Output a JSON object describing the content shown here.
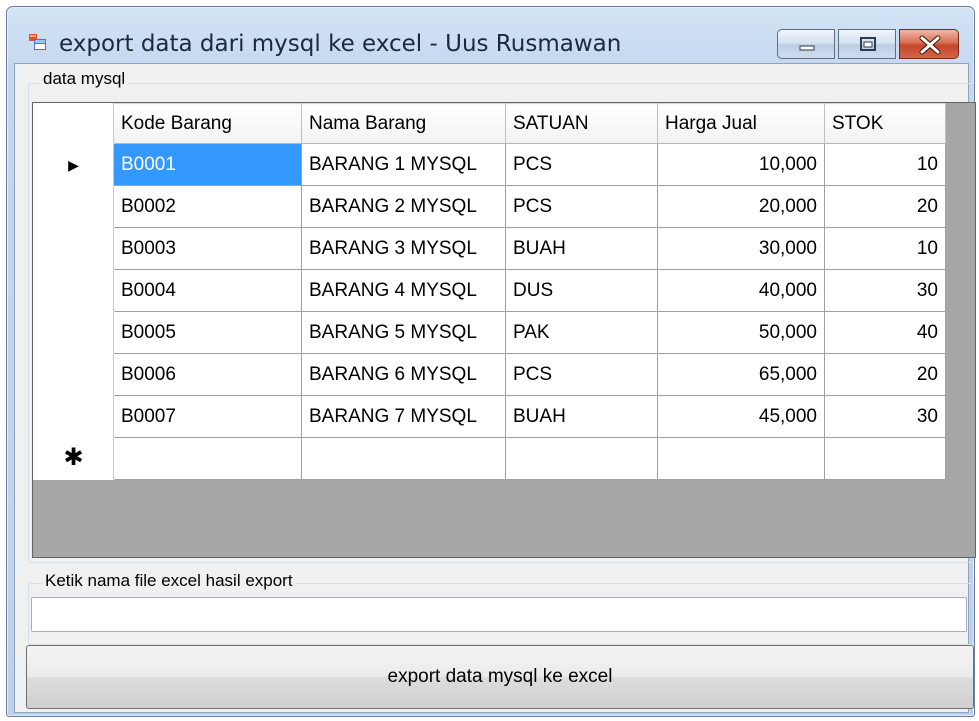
{
  "window": {
    "title": "export data dari mysql ke excel - Uus Rusmawan",
    "icon": "windows-form-icon",
    "controls": [
      "minimize-icon",
      "maximize-icon",
      "close-icon"
    ]
  },
  "group_data": {
    "label": "data mysql"
  },
  "grid": {
    "columns": [
      "Kode Barang",
      "Nama Barang",
      "SATUAN",
      "Harga Jual",
      "STOK"
    ],
    "rows": [
      [
        "B0001",
        "BARANG 1 MYSQL",
        "PCS",
        "10,000",
        "10"
      ],
      [
        "B0002",
        "BARANG 2 MYSQL",
        "PCS",
        "20,000",
        "20"
      ],
      [
        "B0003",
        "BARANG 3 MYSQL",
        "BUAH",
        "30,000",
        "10"
      ],
      [
        "B0004",
        "BARANG 4 MYSQL",
        "DUS",
        "40,000",
        "30"
      ],
      [
        "B0005",
        "BARANG 5 MYSQL",
        "PAK",
        "50,000",
        "40"
      ],
      [
        "B0006",
        "BARANG 6 MYSQL",
        "PCS",
        "65,000",
        "20"
      ],
      [
        "B0007",
        "BARANG 7 MYSQL",
        "BUAH",
        "45,000",
        "30"
      ]
    ],
    "current_row_marker": "▶",
    "new_row_marker": "✱",
    "selected_cell": "B0001"
  },
  "group_file": {
    "label": "Ketik nama file excel hasil export"
  },
  "filename_input": {
    "value": ""
  },
  "export_button": {
    "label": "export data mysql ke excel"
  }
}
